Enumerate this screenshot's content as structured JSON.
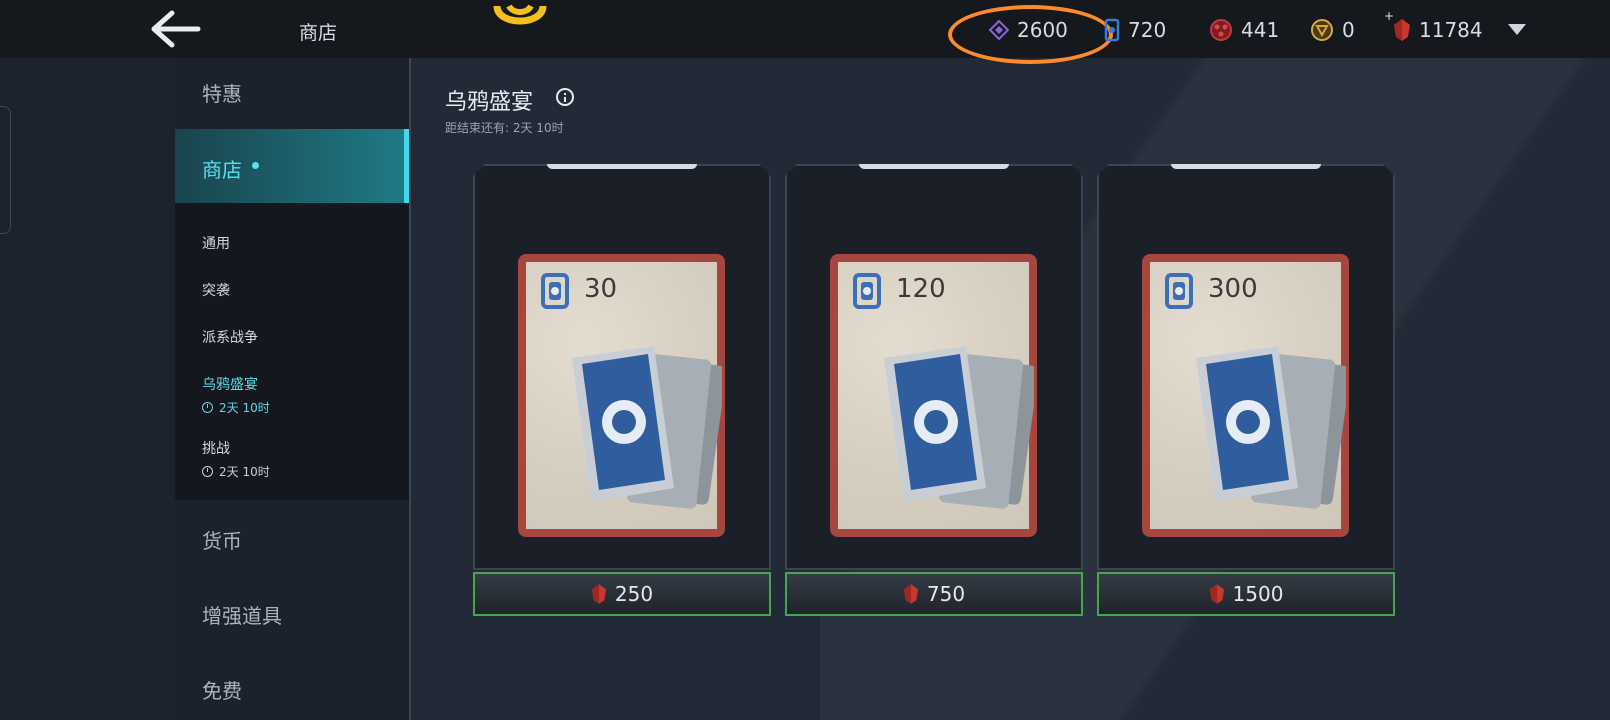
{
  "header": {
    "back_icon": "arrow-left-icon",
    "title": "商店",
    "currencies": [
      {
        "icon": "diamond-shard-icon",
        "value": "2600",
        "color": "#8e62d6"
      },
      {
        "icon": "card-token-icon",
        "value": "720",
        "color": "#3b7bd8"
      },
      {
        "icon": "red-orb-icon",
        "value": "441",
        "color": "#c23a3a"
      },
      {
        "icon": "gold-coin-icon",
        "value": "0",
        "color": "#d9a93b"
      },
      {
        "icon": "gem-icon",
        "value": "11784",
        "color": "#c9372f"
      }
    ],
    "plus_label": "+"
  },
  "nav": {
    "items": [
      {
        "label": "特惠"
      },
      {
        "label": "商店"
      },
      {
        "label": "货币"
      },
      {
        "label": "增强道具"
      },
      {
        "label": "免费"
      }
    ],
    "sub_items": [
      {
        "label": "通用"
      },
      {
        "label": "突袭"
      },
      {
        "label": "派系战争"
      },
      {
        "label": "乌鸦盛宴",
        "time": "2天 10时"
      },
      {
        "label": "挑战",
        "time": "2天 10时"
      }
    ]
  },
  "main": {
    "title": "乌鸦盛宴",
    "countdown": "距结束还有:  2天 10时",
    "offers": [
      {
        "amount": "30",
        "price": "250"
      },
      {
        "amount": "120",
        "price": "750"
      },
      {
        "amount": "300",
        "price": "1500"
      }
    ]
  },
  "colors": {
    "accent": "#5ae0f2",
    "highlight_ring": "#ff8a2b",
    "buy_border": "#46a64f",
    "pack_frame": "#a6463f"
  }
}
